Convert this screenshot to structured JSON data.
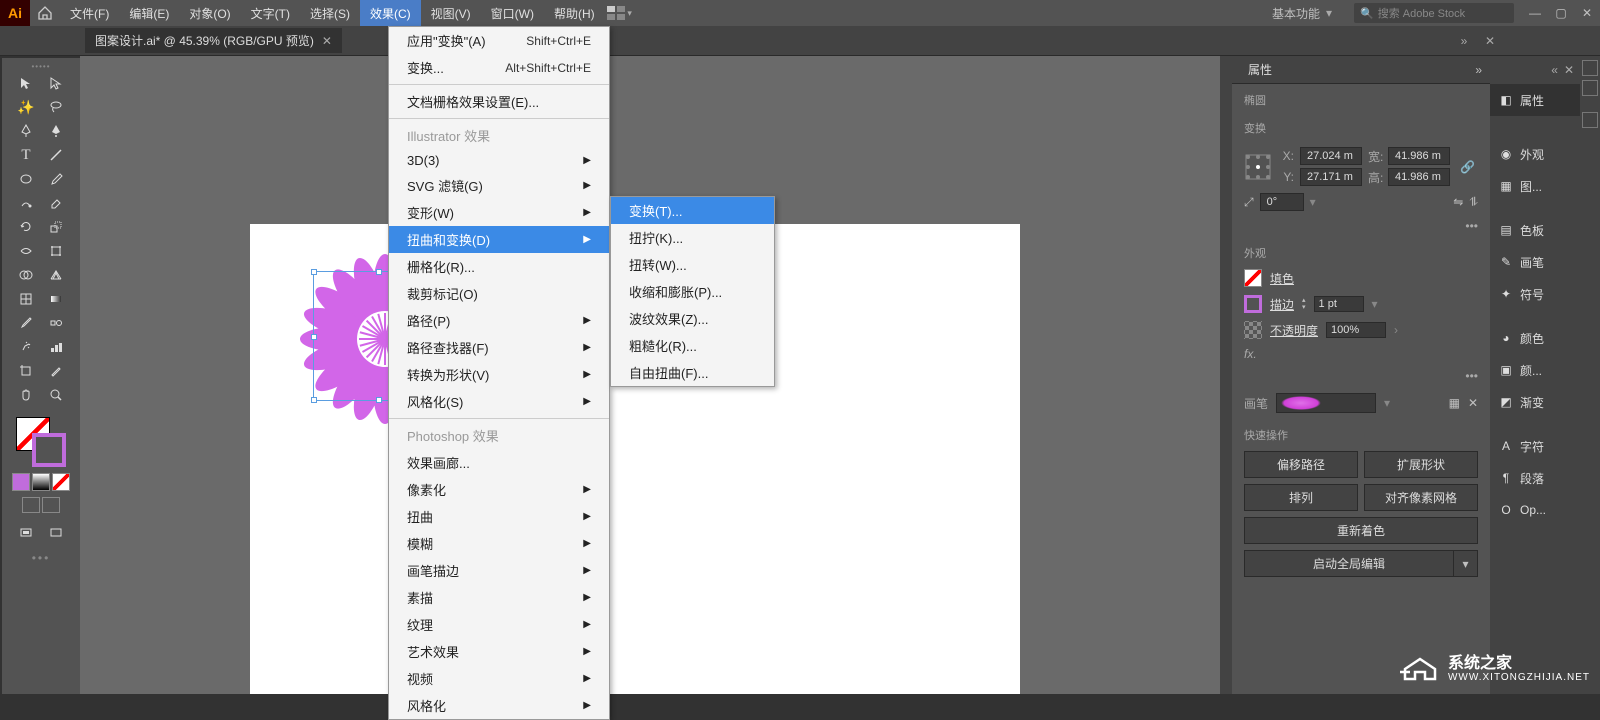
{
  "menubar": {
    "items": [
      "文件(F)",
      "编辑(E)",
      "对象(O)",
      "文字(T)",
      "选择(S)",
      "效果(C)",
      "视图(V)",
      "窗口(W)",
      "帮助(H)"
    ],
    "active_index": 5,
    "workspace": "基本功能",
    "search_placeholder": "搜索 Adobe Stock"
  },
  "document": {
    "tab_title": "图案设计.ai* @ 45.39% (RGB/GPU 预览)"
  },
  "dropdown": {
    "items": [
      {
        "label": "应用\"变换\"(A)",
        "shortcut": "Shift+Ctrl+E"
      },
      {
        "label": "变换...",
        "shortcut": "Alt+Shift+Ctrl+E"
      },
      {
        "sep": true
      },
      {
        "label": "文档栅格效果设置(E)..."
      },
      {
        "sep": true
      },
      {
        "label": "Illustrator 效果",
        "disabled": true
      },
      {
        "label": "3D(3)",
        "arrow": true
      },
      {
        "label": "SVG 滤镜(G)",
        "arrow": true
      },
      {
        "label": "变形(W)",
        "arrow": true
      },
      {
        "label": "扭曲和变换(D)",
        "arrow": true,
        "highlighted": true
      },
      {
        "label": "栅格化(R)..."
      },
      {
        "label": "裁剪标记(O)"
      },
      {
        "label": "路径(P)",
        "arrow": true
      },
      {
        "label": "路径查找器(F)",
        "arrow": true
      },
      {
        "label": "转换为形状(V)",
        "arrow": true
      },
      {
        "label": "风格化(S)",
        "arrow": true
      },
      {
        "sep": true
      },
      {
        "label": "Photoshop 效果",
        "disabled": true
      },
      {
        "label": "效果画廊..."
      },
      {
        "label": "像素化",
        "arrow": true
      },
      {
        "label": "扭曲",
        "arrow": true
      },
      {
        "label": "模糊",
        "arrow": true
      },
      {
        "label": "画笔描边",
        "arrow": true
      },
      {
        "label": "素描",
        "arrow": true
      },
      {
        "label": "纹理",
        "arrow": true
      },
      {
        "label": "艺术效果",
        "arrow": true
      },
      {
        "label": "视频",
        "arrow": true
      },
      {
        "label": "风格化",
        "arrow": true
      }
    ]
  },
  "submenu": {
    "items": [
      {
        "label": "变换(T)...",
        "highlighted": true
      },
      {
        "label": "扭拧(K)..."
      },
      {
        "label": "扭转(W)..."
      },
      {
        "label": "收缩和膨胀(P)..."
      },
      {
        "label": "波纹效果(Z)..."
      },
      {
        "label": "粗糙化(R)..."
      },
      {
        "label": "自由扭曲(F)..."
      }
    ]
  },
  "props": {
    "title": "属性",
    "object_type": "椭圆",
    "transform_title": "变换",
    "x": "27.024 m",
    "y": "27.171 m",
    "w": "41.986 m",
    "h": "41.986 m",
    "w_label": "宽:",
    "h_label": "高:",
    "angle": "0°",
    "appearance_title": "外观",
    "fill_label": "填色",
    "stroke_label": "描边",
    "stroke_weight": "1 pt",
    "opacity_label": "不透明度",
    "opacity_value": "100%",
    "fx": "fx.",
    "brush_label": "画笔",
    "quick_title": "快速操作",
    "btn_offset": "偏移路径",
    "btn_expand": "扩展形状",
    "btn_arrange": "排列",
    "btn_align_pixel": "对齐像素网格",
    "btn_recolor": "重新着色",
    "btn_global_edit": "启动全局编辑"
  },
  "sidebar": {
    "items": [
      {
        "icon": "◧",
        "label": "属性",
        "name": "properties"
      },
      {
        "icon": "◉",
        "label": "外观",
        "name": "appearance"
      },
      {
        "icon": "▦",
        "label": "图...",
        "name": "graphic-styles"
      },
      {
        "icon": "▤",
        "label": "色板",
        "name": "swatches"
      },
      {
        "icon": "✎",
        "label": "画笔",
        "name": "brushes"
      },
      {
        "icon": "✦",
        "label": "符号",
        "name": "symbols"
      },
      {
        "icon": "◕",
        "label": "颜色",
        "name": "color"
      },
      {
        "icon": "▣",
        "label": "颜...",
        "name": "color-guide"
      },
      {
        "icon": "◩",
        "label": "渐变",
        "name": "gradient"
      },
      {
        "icon": "A",
        "label": "字符",
        "name": "character"
      },
      {
        "icon": "¶",
        "label": "段落",
        "name": "paragraph"
      },
      {
        "icon": "O",
        "label": "Op...",
        "name": "opentype"
      }
    ],
    "active_index": 0
  },
  "watermark": {
    "name": "系统之家",
    "domain": "WWW.XITONGZHIJIA.NET"
  }
}
